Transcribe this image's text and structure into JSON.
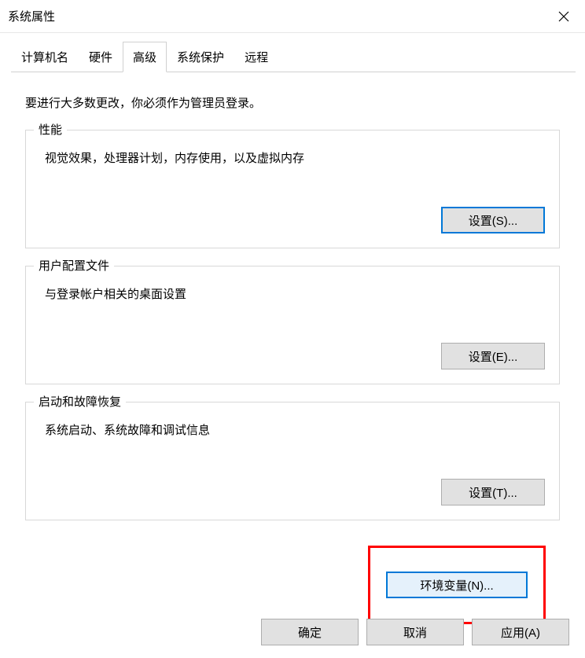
{
  "window": {
    "title": "系统属性"
  },
  "tabs": {
    "items": [
      {
        "label": "计算机名"
      },
      {
        "label": "硬件"
      },
      {
        "label": "高级"
      },
      {
        "label": "系统保护"
      },
      {
        "label": "远程"
      }
    ],
    "active_index": 2
  },
  "content": {
    "intro": "要进行大多数更改，你必须作为管理员登录。"
  },
  "groups": {
    "performance": {
      "title": "性能",
      "desc": "视觉效果，处理器计划，内存使用，以及虚拟内存",
      "button": "设置(S)..."
    },
    "user_profiles": {
      "title": "用户配置文件",
      "desc": "与登录帐户相关的桌面设置",
      "button": "设置(E)..."
    },
    "startup_recovery": {
      "title": "启动和故障恢复",
      "desc": "系统启动、系统故障和调试信息",
      "button": "设置(T)..."
    }
  },
  "env_variables": {
    "button": "环境变量(N)..."
  },
  "footer": {
    "ok": "确定",
    "cancel": "取消",
    "apply": "应用(A)"
  }
}
